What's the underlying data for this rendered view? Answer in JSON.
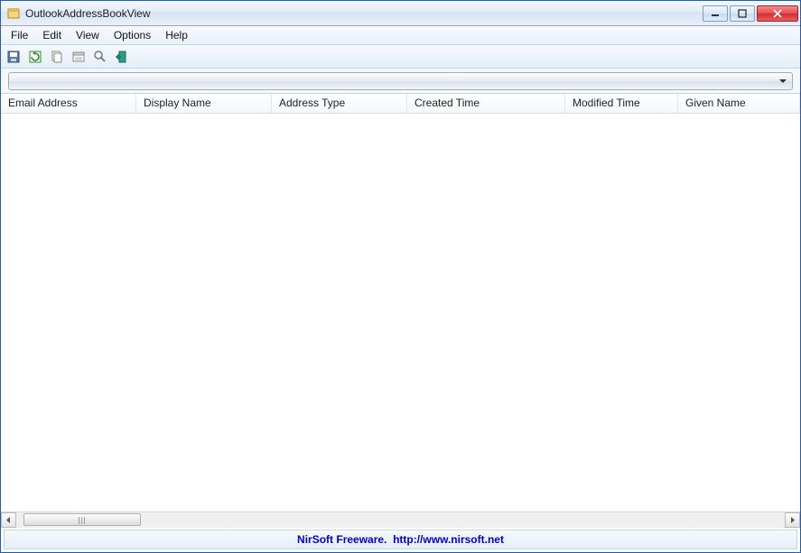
{
  "window": {
    "title": "OutlookAddressBookView"
  },
  "menu": {
    "file": "File",
    "edit": "Edit",
    "view": "View",
    "options": "Options",
    "help": "Help"
  },
  "toolbar_icons": {
    "save": "save-icon",
    "refresh": "refresh-icon",
    "copy": "copy-icon",
    "properties": "properties-icon",
    "find": "find-icon",
    "exit": "exit-icon"
  },
  "dropdown": {
    "selected": ""
  },
  "columns": {
    "email": "Email Address",
    "display": "Display Name",
    "addrtype": "Address Type",
    "created": "Created Time",
    "modified": "Modified Time",
    "given": "Given Name"
  },
  "rows": [],
  "status": {
    "company": "NirSoft Freeware.",
    "url_label": "http://www.nirsoft.net"
  }
}
